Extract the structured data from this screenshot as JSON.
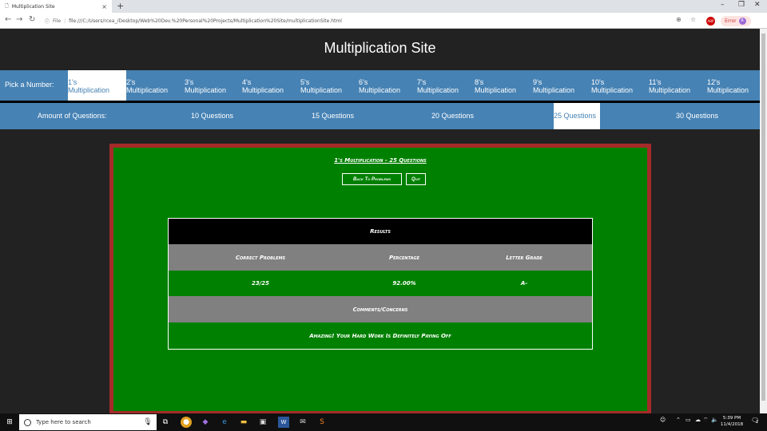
{
  "browser": {
    "tab_title": "Multiplication Site",
    "tab_close": "×",
    "new_tab": "+",
    "file_label": "File",
    "url": "file:///C:/Users/rcea_/Desktop/Web%20Dev.%20Personal%20Projects/Multiplication%20Site/multiplicationSite.html",
    "error_label": "Error",
    "profile_initial": "R",
    "window_controls": [
      "–",
      "❐",
      "✕"
    ]
  },
  "site": {
    "title": "Multiplication Site"
  },
  "number_nav": {
    "label": "Pick a Number:",
    "items": [
      {
        "n": "1's",
        "word": "Multiplication"
      },
      {
        "n": "2's",
        "word": "Multiplication"
      },
      {
        "n": "3's",
        "word": "Multiplication"
      },
      {
        "n": "4's",
        "word": "Multiplication"
      },
      {
        "n": "5's",
        "word": "Multiplication"
      },
      {
        "n": "6's",
        "word": "Multiplication"
      },
      {
        "n": "7's",
        "word": "Multiplication"
      },
      {
        "n": "8's",
        "word": "Multiplication"
      },
      {
        "n": "9's",
        "word": "Multiplication"
      },
      {
        "n": "10's",
        "word": "Multiplication"
      },
      {
        "n": "11's",
        "word": "Multiplication"
      },
      {
        "n": "12's",
        "word": "Multiplication"
      }
    ],
    "active_index": 0
  },
  "question_nav": {
    "label": "Amount of Questions:",
    "items": [
      "10 Questions",
      "15 Questions",
      "20 Questions",
      "25 Questions",
      "30 Questions"
    ],
    "active_index": 3
  },
  "board": {
    "title": "1's Multiplication - 25 Questions",
    "back_button": "Back To Problems",
    "quit_button": "Quit"
  },
  "results": {
    "header": "Results",
    "col_correct": "Correct Problems",
    "col_percentage": "Percentage",
    "col_grade": "Letter Grade",
    "correct": "23/25",
    "percentage": "92.00%",
    "grade": "A-",
    "comments_header": "Comments/Concerns",
    "comment": "Amazing! Your Hard Work Is Definitely Paying Off"
  },
  "colors": {
    "nav_blue": "#4682b4",
    "board_green": "#008000",
    "board_border": "#a52a2a",
    "row_gray": "#808080",
    "page_bg": "#222222"
  },
  "taskbar": {
    "search_placeholder": "Type here to search",
    "time": "5:39 PM",
    "date": "11/4/2018",
    "notification_count": "2"
  }
}
